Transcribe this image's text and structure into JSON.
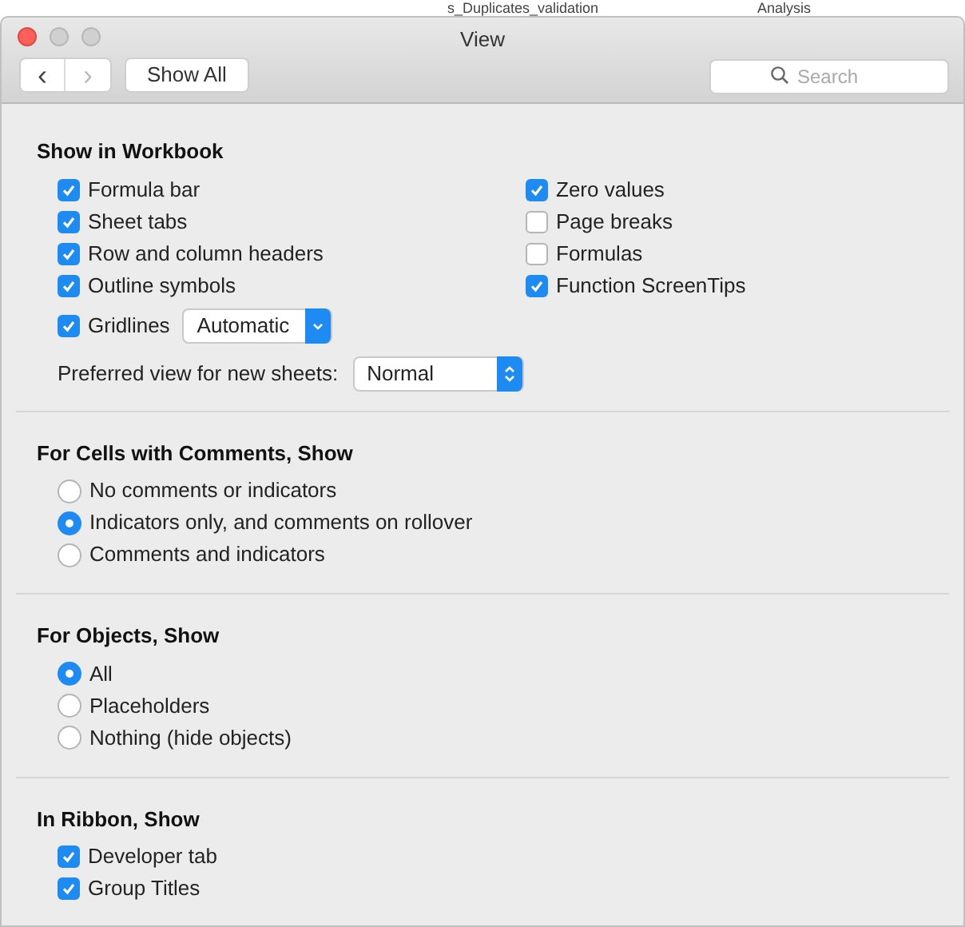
{
  "background_window": {
    "texts": [
      "s_Duplicates_validation",
      "Analysis"
    ]
  },
  "window": {
    "title": "View"
  },
  "toolbar": {
    "back": {
      "label": "‹",
      "disabled": false
    },
    "forward": {
      "label": "›",
      "disabled": true
    },
    "show_all": "Show All",
    "search": {
      "placeholder": "Search"
    }
  },
  "workbook": {
    "heading": "Show in Workbook",
    "left": [
      {
        "label": "Formula bar",
        "checked": true
      },
      {
        "label": "Sheet tabs",
        "checked": true
      },
      {
        "label": "Row and column headers",
        "checked": true
      },
      {
        "label": "Outline symbols",
        "checked": true
      }
    ],
    "right": [
      {
        "label": "Zero values",
        "checked": true
      },
      {
        "label": "Page breaks",
        "checked": false
      },
      {
        "label": "Formulas",
        "checked": false
      },
      {
        "label": "Function ScreenTips",
        "checked": true
      }
    ],
    "gridlines": {
      "label": "Gridlines",
      "checked": true,
      "value": "Automatic"
    },
    "preferred": {
      "label": "Preferred view for new sheets:",
      "value": "Normal"
    }
  },
  "comments": {
    "heading": "For Cells with Comments, Show",
    "options": [
      {
        "label": "No comments or indicators",
        "selected": false
      },
      {
        "label": "Indicators only, and comments on rollover",
        "selected": true
      },
      {
        "label": "Comments and indicators",
        "selected": false
      }
    ]
  },
  "objects": {
    "heading": "For Objects, Show",
    "options": [
      {
        "label": "All",
        "selected": true
      },
      {
        "label": "Placeholders",
        "selected": false
      },
      {
        "label": "Nothing (hide objects)",
        "selected": false
      }
    ]
  },
  "ribbon": {
    "heading": "In Ribbon, Show",
    "items": [
      {
        "label": "Developer tab",
        "checked": true
      },
      {
        "label": "Group Titles",
        "checked": true
      }
    ]
  }
}
